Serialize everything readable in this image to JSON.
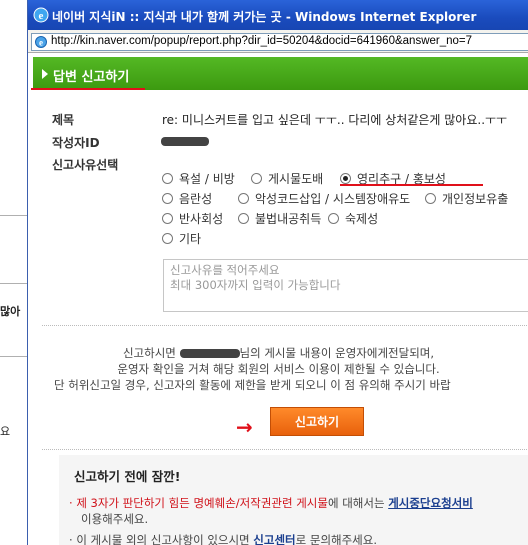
{
  "background": {
    "text_1": "많아",
    "text_2": "요"
  },
  "window": {
    "title": "네이버 지식iN :: 지식과 내가 함께 커가는 곳 - Windows Internet Explorer",
    "url": "http://kin.naver.com/popup/report.php?dir_id=50204&docid=641960&answer_no=7"
  },
  "header": {
    "title": "답변 신고하기"
  },
  "form": {
    "subject_label": "제목",
    "subject_value": "re: 미니스커트를 입고 싶은데 ㅜㅜ.. 다리에 상처같은게 많아요..ㅜㅜ",
    "author_label": "작성자ID",
    "reason_label": "신고사유선택",
    "options": [
      {
        "label": "욕설 / 비방",
        "checked": false
      },
      {
        "label": "게시물도배",
        "checked": false
      },
      {
        "label": "영리추구 / 홍보성",
        "checked": true
      },
      {
        "label": "음란성",
        "checked": false
      },
      {
        "label": "악성코드삽입 / 시스템장애유도",
        "checked": false
      },
      {
        "label": "개인정보유출",
        "checked": false
      },
      {
        "label": "반사회성",
        "checked": false
      },
      {
        "label": "불법내공취득",
        "checked": false
      },
      {
        "label": "숙제성",
        "checked": false
      },
      {
        "label": "기타",
        "checked": false
      }
    ],
    "textarea_line1": "신고사유를 적어주세요",
    "textarea_line2": "최대 300자까지 입력이 가능합니다"
  },
  "notice": {
    "line1_before": "신고하시면",
    "line1_after": "님의 게시물 내용이 운영자에게전달되며,",
    "line2": "운영자 확인을 거쳐 해당 회원의 서비스 이용이 제한될 수 있습니다.",
    "line3": "단 허위신고일 경우, 신고자의 활동에 제한을 받게 되오니 이 점 유의해 주시기 바랍"
  },
  "report_button": "신고하기",
  "tips": {
    "title": "신고하기 전에 잠깐!",
    "line1_bullet": "·",
    "line1_red": "제 3자가 판단하기 힘든 명예훼손/저작권관련 게시물",
    "line1_mid": "에 대해서는",
    "line1_link": "게시중단요청서비",
    "line1_cont": "이용해주세요.",
    "line2_bullet": "·",
    "line2_before": "이 게시물 외의 신고사항이 있으시면",
    "line2_bold": "신고센터",
    "line2_after": "로 문의해주세요."
  },
  "colors": {
    "header_green": "#44a716",
    "accent_red": "#e0101a",
    "button_orange": "#f07a1e"
  }
}
